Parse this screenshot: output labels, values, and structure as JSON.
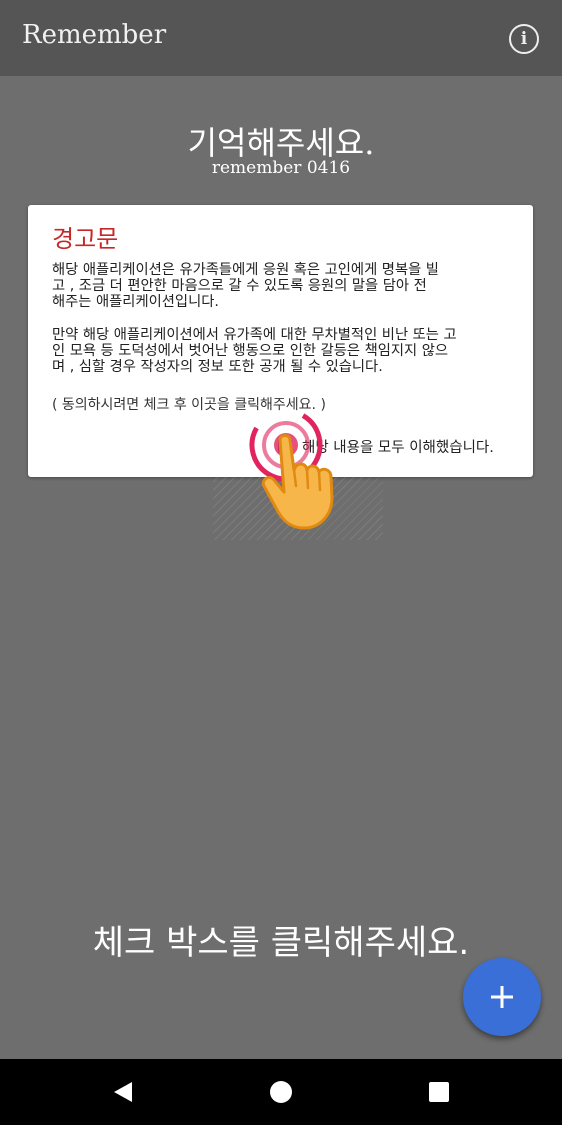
{
  "appbar": {
    "title": "Remember",
    "info_icon": "info-icon"
  },
  "header": {
    "title": "기억해주세요.",
    "subtitle": "remember 0416"
  },
  "dialog": {
    "title": "경고문",
    "paragraph1_lines": [
      "해당 애플리케이션은 유가족들에게 응원 혹은 고인에게 명복을 빌",
      "고 , 조금 더 편안한 마음으로 갈 수 있도록 응원의 말을 담아 전",
      "해주는 애플리케이션입니다."
    ],
    "paragraph2_lines": [
      "만약 해당 애플리케이션에서 유가족에 대한 무차별적인 비난 또는 고",
      "인 모욕 등 도덕성에서 벗어난 행동으로 인한 갈등은 책임지지 않으",
      "며 , 심할 경우 작성자의 정보 또한 공개 될 수 있습니다."
    ],
    "hint": "( 동의하시려면 체크 후 이곳을 클릭해주세요. )",
    "checkbox_label": "해당 내용을 모두 이해했습니다.",
    "checked": false
  },
  "instruction": "체크 박스를 클릭해주세요.",
  "fab": {
    "icon": "plus-icon"
  },
  "navbar": {
    "back_icon": "back-icon",
    "home_icon": "home-icon",
    "recents_icon": "recents-icon"
  },
  "colors": {
    "background": "#6e6e6e",
    "appbar": "#555555",
    "warning_title": "#c62828",
    "fab": "#3b6fd8"
  }
}
